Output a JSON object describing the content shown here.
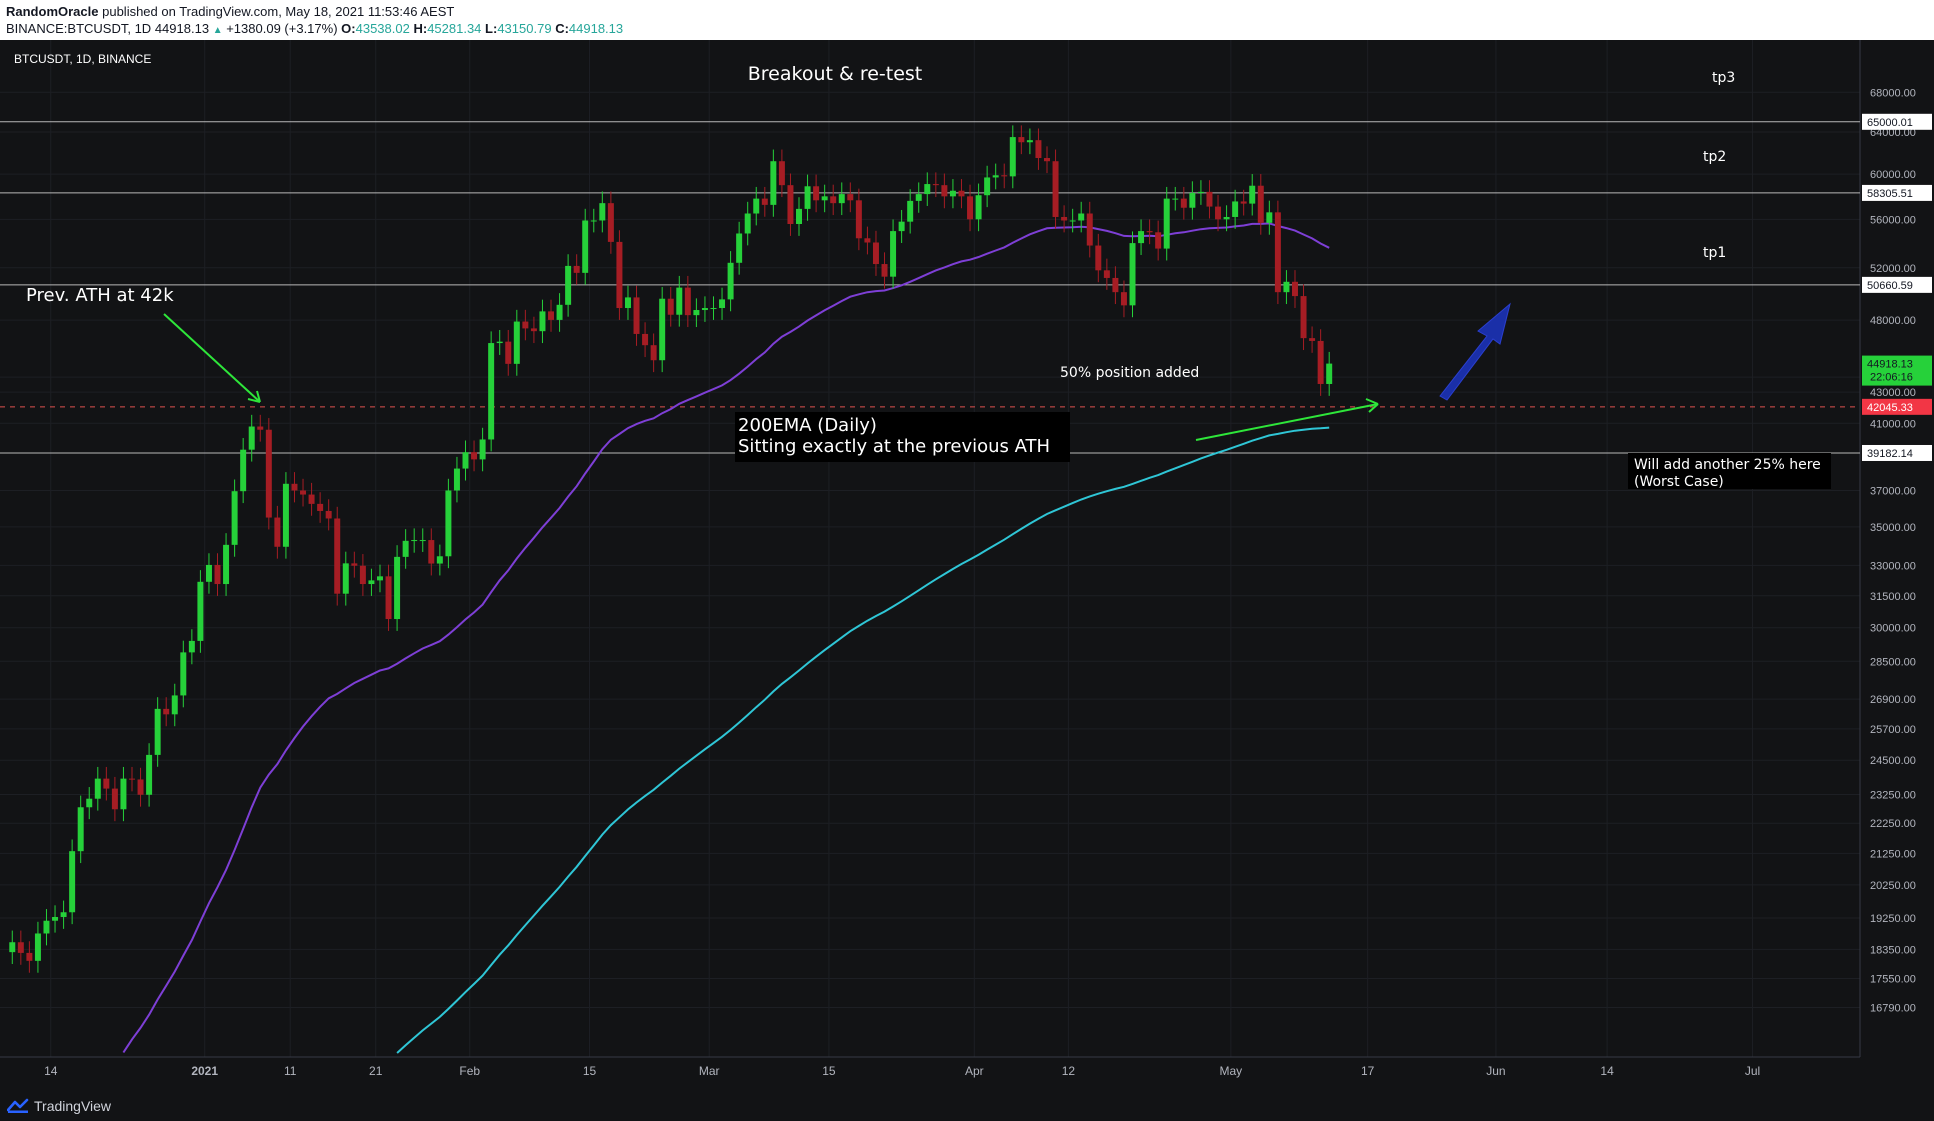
{
  "header": {
    "author": "RandomOracle",
    "published": "published on TradingView.com, May 18, 2021 11:53:46 AEST",
    "symbol": "BINANCE:BTCUSDT, 1D",
    "last": "44918.13",
    "change": "+1380.09 (+3.17%)",
    "o_label": "O:",
    "o": "43538.02",
    "h_label": "H:",
    "h": "45281.34",
    "l_label": "L:",
    "l": "43150.79",
    "c_label": "C:",
    "c": "44918.13"
  },
  "chart_title": "BTCUSDT, 1D, BINANCE",
  "footer": {
    "brand": "TradingView"
  },
  "colors": {
    "background": "#121315",
    "up": "#26d13a",
    "down": "#a61d24",
    "ema_purple": "#7e3fd6",
    "ema_cyan": "#2fc6d6",
    "level_line": "#b8b8b8",
    "ath_dashed": "#e0514f",
    "arrow_green": "#2ee63a",
    "arrow_blue": "#1a2fa8"
  },
  "chart_data": {
    "type": "candlestick",
    "scale": "log",
    "ylim": [
      16000,
      69500
    ],
    "y_ticks": [
      "68000.00",
      "64000.00",
      "60000.00",
      "56000.00",
      "52000.00",
      "48000.00",
      "44000.00",
      "43000.00",
      "41000.00",
      "37000.00",
      "35000.00",
      "33000.00",
      "31500.00",
      "30000.00",
      "28500.00",
      "26900.00",
      "25700.00",
      "24500.00",
      "23250.00",
      "22250.00",
      "21250.00",
      "20250.00",
      "19250.00",
      "18350.00",
      "17550.00",
      "16790.00"
    ],
    "y_tick_values": [
      68000,
      64000,
      60000,
      56000,
      52000,
      48000,
      44000,
      43000,
      41000,
      37000,
      35000,
      33000,
      31500,
      30000,
      28500,
      26900,
      25700,
      24500,
      23250,
      22250,
      21250,
      20250,
      19250,
      18350,
      17550,
      16790
    ],
    "x_ticks": [
      {
        "label": "14",
        "date": "2020-12-14"
      },
      {
        "label": "2021",
        "date": "2021-01-01"
      },
      {
        "label": "11",
        "date": "2021-01-11"
      },
      {
        "label": "21",
        "date": "2021-01-21"
      },
      {
        "label": "Feb",
        "date": "2021-02-01"
      },
      {
        "label": "15",
        "date": "2021-02-15"
      },
      {
        "label": "Mar",
        "date": "2021-03-01"
      },
      {
        "label": "15",
        "date": "2021-03-15"
      },
      {
        "label": "Apr",
        "date": "2021-04-01"
      },
      {
        "label": "12",
        "date": "2021-04-12"
      },
      {
        "label": "May",
        "date": "2021-05-01"
      },
      {
        "label": "17",
        "date": "2021-05-17"
      },
      {
        "label": "Jun",
        "date": "2021-06-01"
      },
      {
        "label": "14",
        "date": "2021-06-14"
      },
      {
        "label": "Jul",
        "date": "2021-07-01"
      }
    ],
    "x_range": [
      "2020-12-09",
      "2021-07-11"
    ],
    "candle_start_date": "2020-12-09",
    "candles_close": [
      18550,
      18250,
      18030,
      18800,
      19170,
      19280,
      19420,
      21320,
      22800,
      23100,
      23820,
      23460,
      22730,
      23820,
      23790,
      23240,
      24700,
      26500,
      26280,
      27050,
      28890,
      29400,
      32180,
      33020,
      32070,
      34050,
      36960,
      39380,
      40800,
      40600,
      35500,
      33950,
      37380,
      37000,
      36770,
      36250,
      35860,
      35450,
      31600,
      33100,
      32980,
      32070,
      32250,
      32450,
      30400,
      33430,
      34260,
      34300,
      34300,
      33090,
      33460,
      37000,
      38260,
      39230,
      38800,
      40000,
      46350,
      46450,
      44900,
      47900,
      47400,
      47200,
      48650,
      48020,
      49140,
      52150,
      51600,
      55900,
      55900,
      57400,
      54100,
      48900,
      49700,
      47000,
      46200,
      45150,
      49600,
      48400,
      50450,
      48370,
      48750,
      48900,
      48900,
      49550,
      52400,
      54800,
      56500,
      57800,
      57250,
      61200,
      59000,
      55600,
      56900,
      58900,
      57650,
      58000,
      57400,
      58200,
      57650,
      54400,
      54050,
      52300,
      51300,
      55000,
      55800,
      57600,
      58200,
      59100,
      59000,
      58000,
      58500,
      58000,
      56000,
      58100,
      59700,
      59900,
      59800,
      63500,
      63000,
      63200,
      61500,
      61200,
      56200,
      55900,
      55900,
      56500,
      53800,
      51800,
      51200,
      50100,
      49100,
      54000,
      55000,
      54900,
      53550,
      57800,
      57800,
      57000,
      58300,
      58400,
      57100,
      56000,
      56200,
      57550,
      57360,
      58950,
      55700,
      56600,
      50100,
      50900,
      49800,
      46700,
      46500,
      43540,
      44918
    ],
    "annotations": [
      {
        "text": "Breakout & re-test"
      },
      {
        "text": "Prev. ATH at 42k"
      },
      {
        "text": "50% position added"
      },
      {
        "text": "200EMA (Daily)"
      },
      {
        "text": "Sitting exactly at the previous ATH"
      },
      {
        "text": "Will add another 25% here"
      },
      {
        "text": "(Worst Case)"
      },
      {
        "text": "tp3"
      },
      {
        "text": "tp2"
      },
      {
        "text": "tp1"
      }
    ],
    "levels": [
      {
        "name": "tp3",
        "value": 65000.01,
        "label": "65000.01",
        "style": "solid"
      },
      {
        "name": "tp2",
        "value": 58305.51,
        "label": "58305.51",
        "style": "solid"
      },
      {
        "name": "tp1",
        "value": 50660.59,
        "label": "50660.59",
        "style": "solid"
      },
      {
        "name": "prev-ath",
        "value": 42045.33,
        "label": "42045.33",
        "style": "dashed"
      },
      {
        "name": "worst-case",
        "value": 39182.14,
        "label": "39182.14",
        "style": "solid"
      }
    ],
    "price_label": {
      "value": 44918.13,
      "label": "44918.13",
      "countdown": "22:06:16"
    }
  }
}
